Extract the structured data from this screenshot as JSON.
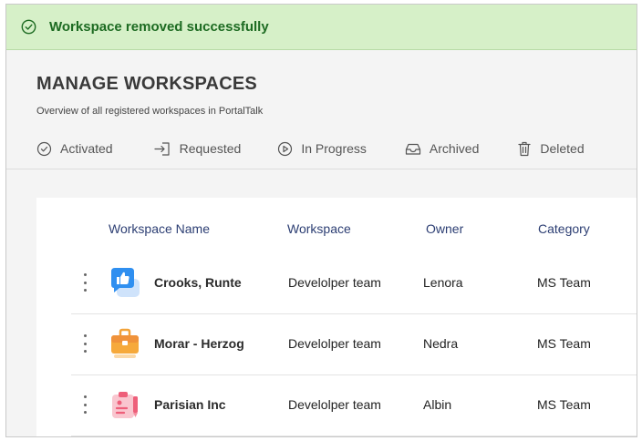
{
  "banner": {
    "message": "Workspace removed successfully",
    "icon": "check-circle-icon",
    "color": "#1d6b22"
  },
  "header": {
    "title": "MANAGE WORKSPACES",
    "subtitle": "Overview of all registered workspaces in PortalTalk"
  },
  "tabs": [
    {
      "label": "Activated",
      "icon": "check-circle-icon"
    },
    {
      "label": "Requested",
      "icon": "enter-icon"
    },
    {
      "label": "In Progress",
      "icon": "play-circle-icon"
    },
    {
      "label": "Archived",
      "icon": "inbox-icon"
    },
    {
      "label": "Deleted",
      "icon": "trash-icon"
    }
  ],
  "table": {
    "columns": [
      "Workspace Name",
      "Workspace",
      "Owner",
      "Category"
    ],
    "rows": [
      {
        "name": "Crooks, Runte",
        "workspace": "Develolper team",
        "owner": "Lenora",
        "category": "MS Team",
        "icon": "thumbs-up-chat-icon"
      },
      {
        "name": "Morar - Herzog",
        "workspace": "Develolper team",
        "owner": "Nedra",
        "category": "MS Team",
        "icon": "briefcase-icon"
      },
      {
        "name": "Parisian Inc",
        "workspace": "Develolper team",
        "owner": "Albin",
        "category": "MS Team",
        "icon": "clipboard-pen-icon"
      }
    ]
  }
}
